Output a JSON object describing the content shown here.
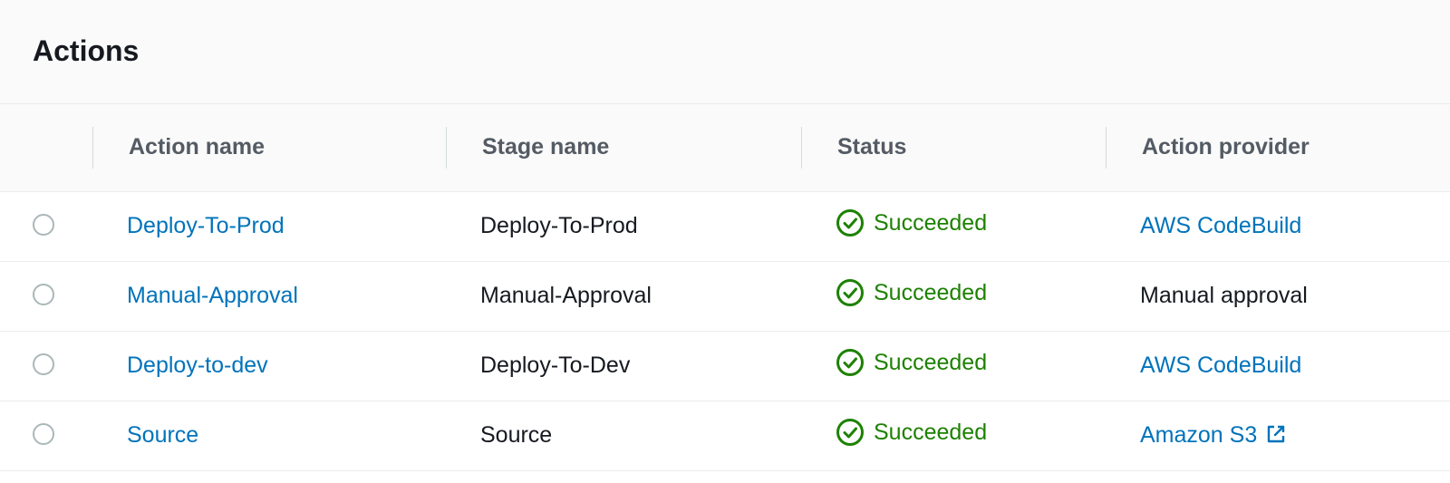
{
  "panel": {
    "title": "Actions"
  },
  "table": {
    "columns": {
      "action_name": "Action name",
      "stage_name": "Stage name",
      "status": "Status",
      "action_provider": "Action provider"
    },
    "rows": [
      {
        "action_name": "Deploy-To-Prod",
        "stage_name": "Deploy-To-Prod",
        "status": "Succeeded",
        "status_icon": "check-circle-icon",
        "provider": "AWS CodeBuild",
        "provider_is_link": true,
        "provider_external": false
      },
      {
        "action_name": "Manual-Approval",
        "stage_name": "Manual-Approval",
        "status": "Succeeded",
        "status_icon": "check-circle-icon",
        "provider": "Manual approval",
        "provider_is_link": false,
        "provider_external": false
      },
      {
        "action_name": "Deploy-to-dev",
        "stage_name": "Deploy-To-Dev",
        "status": "Succeeded",
        "status_icon": "check-circle-icon",
        "provider": "AWS CodeBuild",
        "provider_is_link": true,
        "provider_external": false
      },
      {
        "action_name": "Source",
        "stage_name": "Source",
        "status": "Succeeded",
        "status_icon": "check-circle-icon",
        "provider": "Amazon S3",
        "provider_is_link": true,
        "provider_external": true
      }
    ]
  },
  "colors": {
    "link": "#0073bb",
    "success": "#1d8102",
    "header_bg": "#fafafa",
    "text": "#16191f",
    "header_text": "#545b64"
  }
}
